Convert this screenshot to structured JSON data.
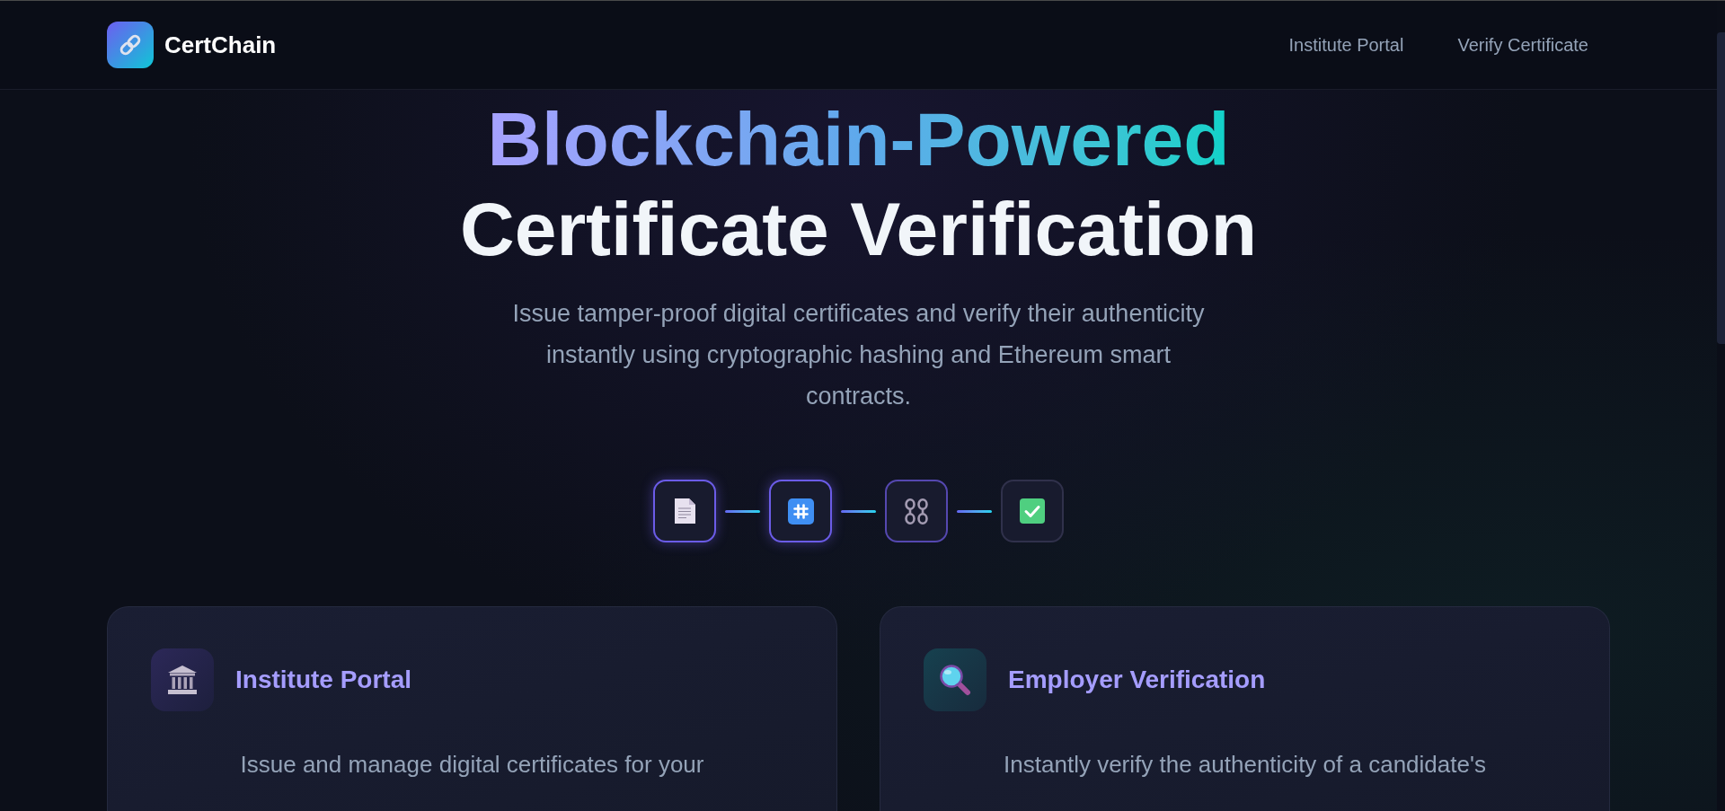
{
  "header": {
    "brand": "CertChain",
    "nav": [
      {
        "label": "Institute Portal"
      },
      {
        "label": "Verify Certificate"
      }
    ]
  },
  "hero": {
    "title_highlight": "Blockchain-Powered",
    "title": "Certificate Verification",
    "subtitle": "Issue tamper-proof digital certificates and verify their authenticity instantly using cryptographic hashing and Ethereum smart contracts."
  },
  "steps": [
    {
      "kind": "document",
      "active": true,
      "glow": true
    },
    {
      "kind": "hash",
      "active": true,
      "glow": true
    },
    {
      "kind": "chain",
      "active": true,
      "glow": false
    },
    {
      "kind": "check",
      "active": false,
      "glow": false
    }
  ],
  "cards": [
    {
      "kind": "institute",
      "title": "Institute Portal",
      "description": "Issue and manage digital certificates for your"
    },
    {
      "kind": "employer",
      "title": "Employer Verification",
      "description": "Instantly verify the authenticity of a candidate's"
    }
  ]
}
